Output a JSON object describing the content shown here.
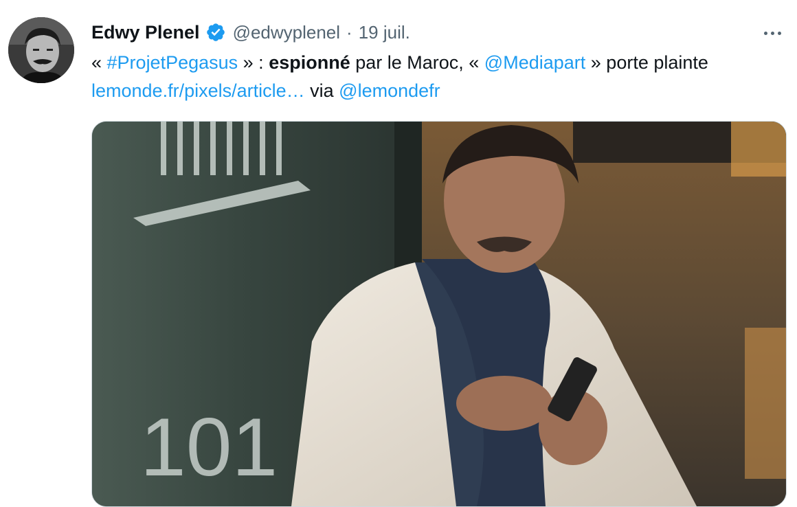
{
  "author": {
    "name": "Edwy Plenel",
    "handle": "@edwyplenel",
    "separator": "·",
    "date": "19 juil.",
    "verified_icon": "verified-badge-icon",
    "accent": "#1d9bf0"
  },
  "tweet": {
    "line1": {
      "open_quote": "« ",
      "hashtag": "#ProjetPegasus",
      "close_colon": " » : ",
      "bold_word": "espionné",
      "mid_text": " par le Maroc, « ",
      "mention": "@Mediapart",
      "end_text": " » porte plainte"
    },
    "line2": {
      "url": "lemonde.fr/pixels/article…",
      "via": " via ",
      "via_mention": "@lemondefr"
    }
  },
  "media": {
    "door_number": "101"
  },
  "more_icon": "more-horizontal-icon"
}
